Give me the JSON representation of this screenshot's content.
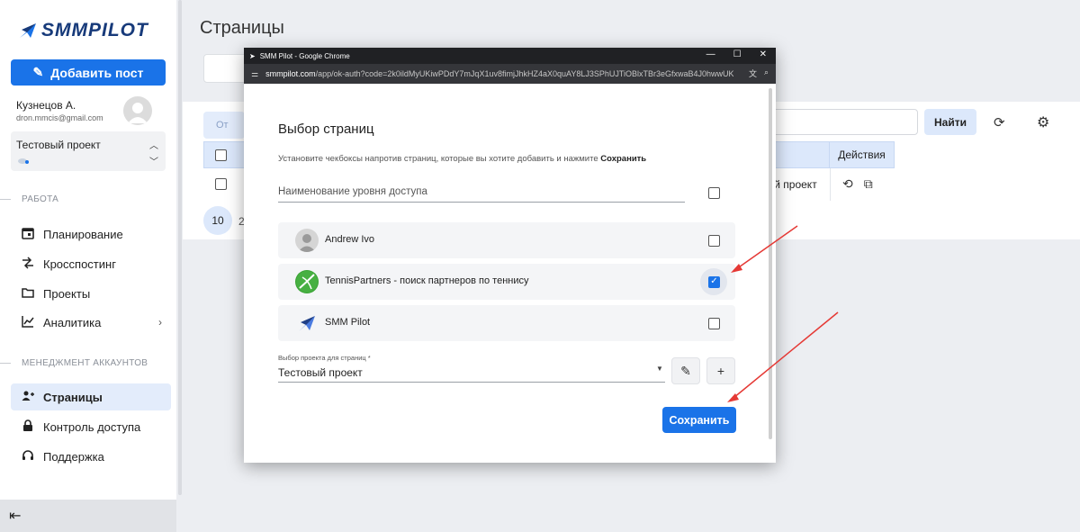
{
  "sidebar": {
    "logo_text": "SMMPILOT",
    "add_post_label": "Добавить пост",
    "user_name": "Кузнецов А.",
    "user_email": "dron.mmcis@gmail.com",
    "project_name": "Тестовый проект",
    "section_work": "РАБОТА",
    "section_accounts": "МЕНЕДЖМЕНТ АККАУНТОВ",
    "items": [
      {
        "label": "Планирование",
        "icon": "calendar-icon"
      },
      {
        "label": "Кросспостинг",
        "icon": "crosspost-icon"
      },
      {
        "label": "Проекты",
        "icon": "folder-icon"
      },
      {
        "label": "Аналитика",
        "icon": "chart-icon"
      },
      {
        "label": "Страницы",
        "icon": "add-user-icon",
        "active": true
      },
      {
        "label": "Контроль доступа",
        "icon": "lock-icon"
      },
      {
        "label": "Поддержка",
        "icon": "headset-icon"
      }
    ],
    "collapse_icon": "collapse-icon"
  },
  "main": {
    "page_title": "Страницы",
    "ghost_button_label": "От",
    "find_button_label": "Найти",
    "table": {
      "actions_header": "Действия",
      "row_project": "ный проект"
    },
    "page_size": "10",
    "page_size_next": "2"
  },
  "popup": {
    "window_title": "SMM Pilot - Google Chrome",
    "url_host": "smmpilot.com",
    "url_path": "/app/ok-auth?code=2k0ildMyUKiwPDdY7mJqX1uv8fimjJhkHZ4aX0quAY8LJ3SPhUJTiOBlxTBr3eGfxwaB4J0hwwUKKF9c...",
    "title": "Выбор страниц",
    "hint_text": "Установите чекбоксы напротив страниц, которые вы хотите добавить и нажмите ",
    "hint_bold": "Сохранить",
    "access_placeholder": "Наименование уровня доступа",
    "pages": [
      {
        "name": "Andrew Ivo",
        "checked": false
      },
      {
        "name": "TennisPartners - поиск партнеров по теннису",
        "checked": true
      },
      {
        "name": "SMM Pilot",
        "checked": false
      }
    ],
    "project_label": "Выбор проекта для страниц *",
    "project_value": "Тестовый проект",
    "save_label": "Сохранить"
  },
  "colors": {
    "accent": "#1a73e8",
    "arrow": "#e53935",
    "titlebar": "#202124"
  }
}
